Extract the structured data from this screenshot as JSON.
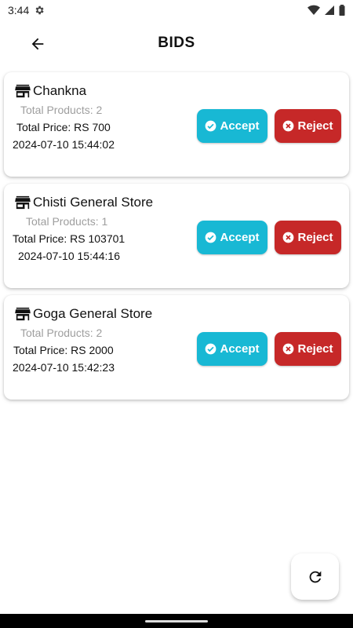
{
  "status_bar": {
    "time": "3:44"
  },
  "app_bar": {
    "title": "BIDS"
  },
  "bids": [
    {
      "store": "Chankna",
      "total_products": "Total Products: 2",
      "total_price": "Total Price: RS 700",
      "datetime": "2024-07-10 15:44:02"
    },
    {
      "store": "Chisti General Store",
      "total_products": "Total Products: 1",
      "total_price": "Total Price: RS 103701",
      "datetime": "2024-07-10 15:44:16"
    },
    {
      "store": "Goga General Store",
      "total_products": "Total Products: 2",
      "total_price": "Total Price: RS 2000",
      "datetime": "2024-07-10 15:42:23"
    }
  ],
  "actions": {
    "accept_label": "Accept",
    "reject_label": "Reject"
  },
  "colors": {
    "accept": "#18b8d4",
    "reject": "#c62828"
  },
  "icons": {
    "back": "arrow-back-icon",
    "store": "store-icon",
    "accept": "check-circle-icon",
    "reject": "cancel-circle-icon",
    "refresh": "refresh-icon"
  }
}
